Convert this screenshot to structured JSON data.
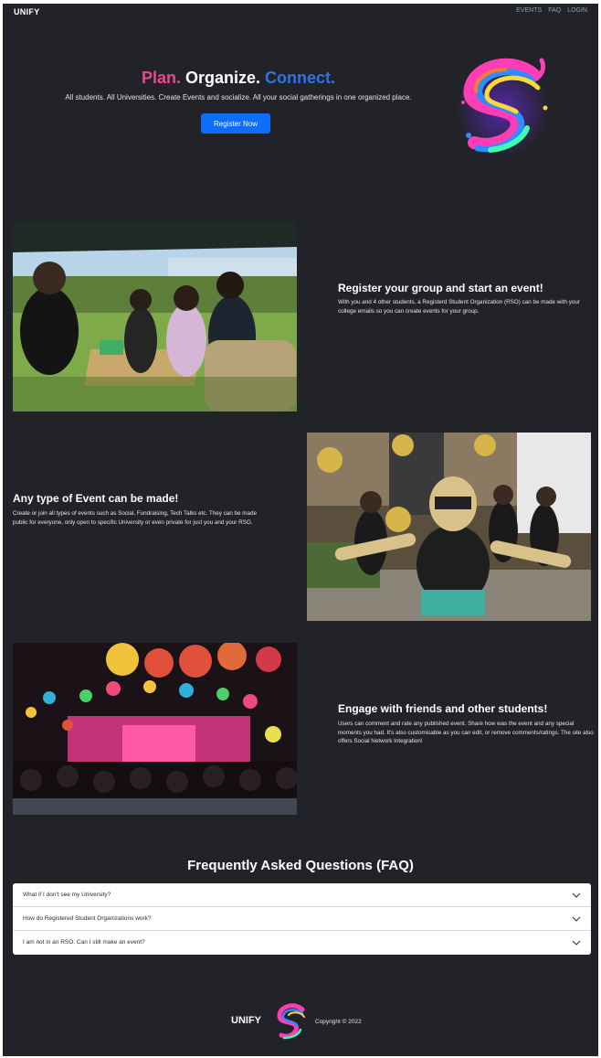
{
  "nav": {
    "brand": "UNIFY",
    "links": [
      "EVENTS",
      "FAQ",
      "LOGIN"
    ]
  },
  "hero": {
    "title_part1": "Plan.",
    "title_part2": "Organize.",
    "title_part3": "Connect.",
    "subtitle": "All students. All Universities. Create Events and socialize. All your social gatherings in one organized place.",
    "button_label": "Register Now"
  },
  "features": [
    {
      "heading": "Register your group and start an event!",
      "text": "With you and 4 other students, a Registerd Student Organization (RSO) can be made with your college emails so you can create events for your group."
    },
    {
      "heading": "Any type of Event can be made!",
      "text": "Create or join all types of events such as Social, Fundraising, Tech Talks etc. They can be made public for everyone, only open to specific University or even private for just you and your RSO."
    },
    {
      "heading": "Engage with friends and other students!",
      "text": "Users can comment and rate any published event. Share how was the event and any special moments you had. It's also customisable as you can edit, or remove comments/ratings. The site also offers Social Network Integration!"
    }
  ],
  "faq": {
    "title": "Frequently Asked Questions (FAQ)",
    "items": [
      "What if I don't see my University?",
      "How do Registered Student Organizations work?",
      "I am not in an RSO. Can I still make an event?"
    ]
  },
  "footer": {
    "brand": "UNIFY",
    "copyright": "Copyright © 2022"
  },
  "colors": {
    "background": "#212328",
    "accent_pink": "#e8488f",
    "accent_blue": "#2c74e8",
    "button": "#0d6efd"
  },
  "icons": {
    "logo": "colorful-swirl-logo",
    "faq_toggle": "chevron-down-icon"
  }
}
